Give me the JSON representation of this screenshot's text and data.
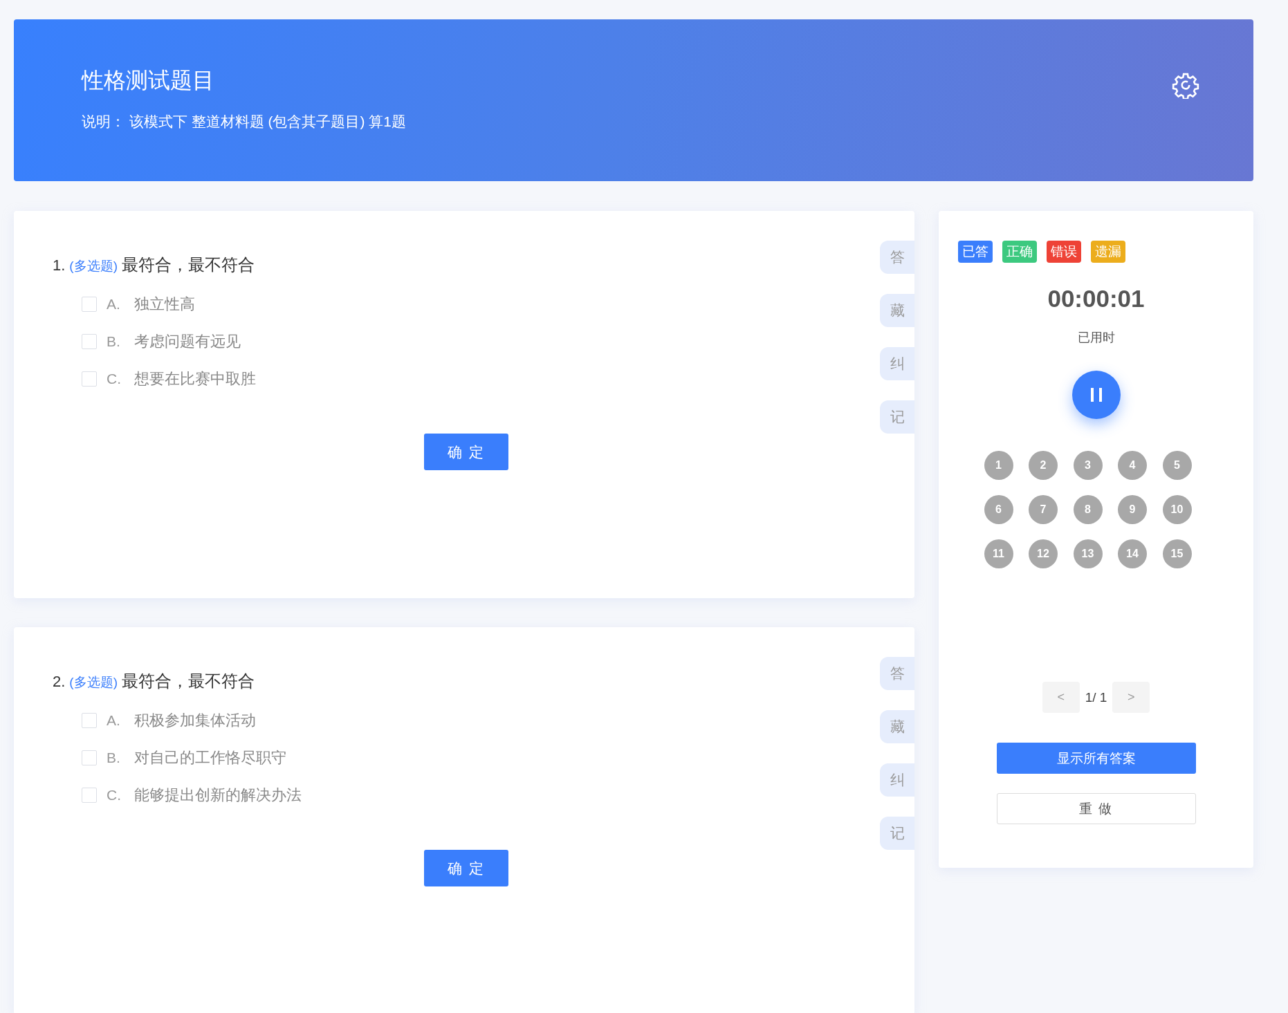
{
  "header": {
    "title": "性格测试题目",
    "description": "说明： 该模式下 整道材料题 (包含其子题目) 算1题"
  },
  "questions": [
    {
      "number": "1.",
      "type_tag": "(多选题)",
      "text": "最符合，最不符合",
      "options": [
        {
          "letter": "A.",
          "text": "独立性高",
          "checked": false
        },
        {
          "letter": "B.",
          "text": "考虑问题有远见",
          "checked": false
        },
        {
          "letter": "C.",
          "text": "想要在比赛中取胜",
          "checked": false
        }
      ],
      "confirm": "确 定",
      "side_tabs": [
        "答",
        "藏",
        "纠",
        "记"
      ]
    },
    {
      "number": "2.",
      "type_tag": "(多选题)",
      "text": "最符合，最不符合",
      "options": [
        {
          "letter": "A.",
          "text": "积极参加集体活动",
          "checked": false
        },
        {
          "letter": "B.",
          "text": "对自己的工作恪尽职守",
          "checked": false
        },
        {
          "letter": "C.",
          "text": "能够提出创新的解决办法",
          "checked": false
        }
      ],
      "confirm": "确 定",
      "side_tabs": [
        "答",
        "藏",
        "纠",
        "记"
      ]
    }
  ],
  "panel": {
    "legend": [
      {
        "label": "已答",
        "color": "#3a7efc"
      },
      {
        "label": "正确",
        "color": "#3cc97f"
      },
      {
        "label": "错误",
        "color": "#ee4236"
      },
      {
        "label": "遗漏",
        "color": "#ecad1c"
      }
    ],
    "timer": "00:00:01",
    "timer_label": "已用时",
    "numbers": [
      "1",
      "2",
      "3",
      "4",
      "5",
      "6",
      "7",
      "8",
      "9",
      "10",
      "11",
      "12",
      "13",
      "14",
      "15"
    ],
    "pagination": {
      "prev": "<",
      "page": "1/ 1",
      "next": ">"
    },
    "show_answers": "显示所有答案",
    "redo": "重 做"
  }
}
